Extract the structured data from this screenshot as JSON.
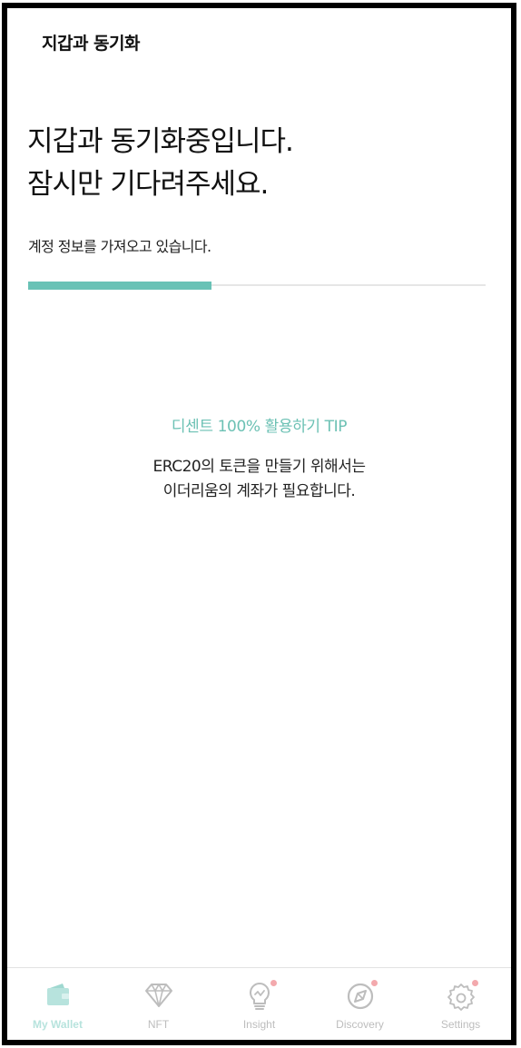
{
  "header": {
    "title": "지갑과 동기화"
  },
  "main": {
    "headline_line1": "지갑과 동기화중입니다.",
    "headline_line2": "잠시만 기다려주세요.",
    "status": "계정 정보를 가져오고 있습니다.",
    "progress": 0.4
  },
  "tip": {
    "title": "디센트 100% 활용하기 TIP",
    "line1": "ERC20의 토큰을 만들기 위해서는",
    "line2": "이더리움의 계좌가 필요합니다."
  },
  "tabs": [
    {
      "label": "My Wallet",
      "icon": "wallet-icon",
      "active": true,
      "badge": false
    },
    {
      "label": "NFT",
      "icon": "diamond-icon",
      "active": false,
      "badge": false
    },
    {
      "label": "Insight",
      "icon": "lightbulb-icon",
      "active": false,
      "badge": true
    },
    {
      "label": "Discovery",
      "icon": "compass-icon",
      "active": false,
      "badge": true
    },
    {
      "label": "Settings",
      "icon": "gear-icon",
      "active": false,
      "badge": true
    }
  ],
  "colors": {
    "accent": "#69c2b6",
    "tip_text": "#6cc1b4",
    "active_tab": "#b7e3dd",
    "inactive_tab": "#bdbdbd",
    "badge": "#f3a9ad"
  }
}
